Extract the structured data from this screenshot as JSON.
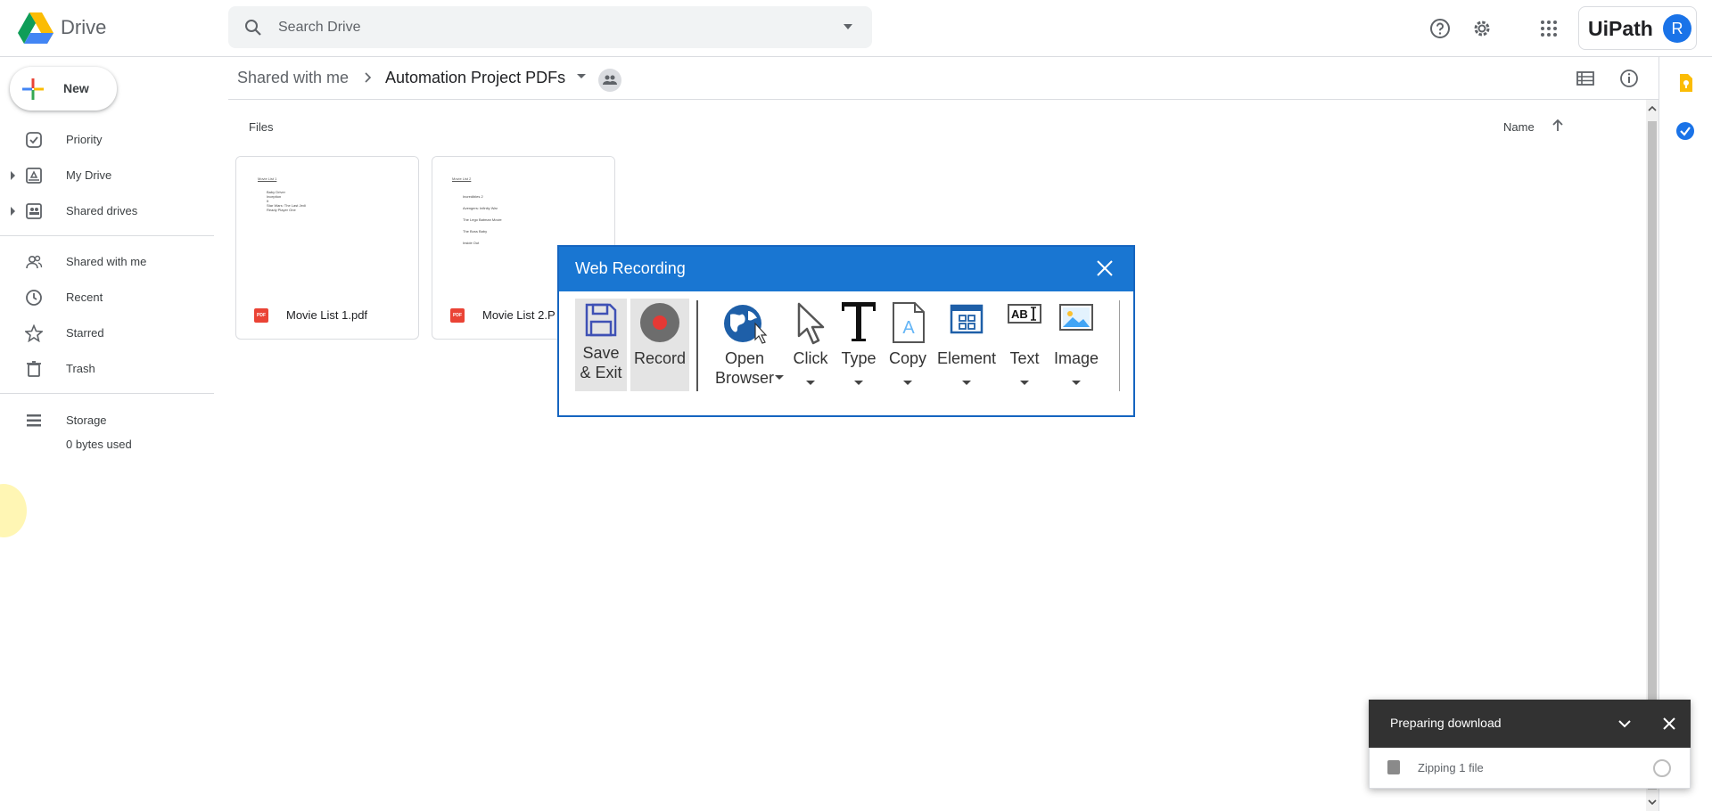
{
  "app": {
    "name": "Drive"
  },
  "search": {
    "placeholder": "Search Drive"
  },
  "header": {
    "account_brand": "UiPath",
    "avatar_initial": "R"
  },
  "sidebar": {
    "new_label": "New",
    "items": [
      {
        "label": "Priority",
        "icon": "priority-icon"
      },
      {
        "label": "My Drive",
        "icon": "my-drive-icon"
      },
      {
        "label": "Shared drives",
        "icon": "shared-drives-icon"
      },
      {
        "label": "Shared with me",
        "icon": "shared-with-me-icon"
      },
      {
        "label": "Recent",
        "icon": "clock-icon"
      },
      {
        "label": "Starred",
        "icon": "star-icon"
      },
      {
        "label": "Trash",
        "icon": "trash-icon"
      },
      {
        "label": "Storage",
        "icon": "storage-icon"
      }
    ],
    "storage_used": "0 bytes used"
  },
  "breadcrumb": {
    "parent": "Shared with me",
    "current": "Automation Project PDFs"
  },
  "files": {
    "section_label": "Files",
    "sort_label": "Name",
    "items": [
      {
        "name": "Movie List 1.pdf",
        "type_badge": "PDF",
        "thumb_title": "Movie List 1",
        "thumb_lines": [
          "Baby Driver",
          "Inception",
          "It",
          "Star Wars: The Last Jedi",
          "Ready Player One"
        ]
      },
      {
        "name": "Movie List 2.P",
        "type_badge": "PDF",
        "thumb_title": "Movie List 2",
        "thumb_lines": [
          "Incredibles 2",
          "Avengers: Infinity War",
          "The Lego Batman Movie",
          "The Boss Baby",
          "Inside Out"
        ]
      }
    ]
  },
  "recorder": {
    "title": "Web Recording",
    "tools": [
      {
        "label": "Save & Exit",
        "icon": "save-icon"
      },
      {
        "label": "Record",
        "icon": "record-icon"
      },
      {
        "label": "Open Browser",
        "icon": "globe-icon"
      },
      {
        "label": "Click",
        "icon": "cursor-icon"
      },
      {
        "label": "Type",
        "icon": "type-icon"
      },
      {
        "label": "Copy",
        "icon": "copy-icon"
      },
      {
        "label": "Element",
        "icon": "element-icon"
      },
      {
        "label": "Text",
        "icon": "text-icon"
      },
      {
        "label": "Image",
        "icon": "image-icon"
      }
    ]
  },
  "download": {
    "title": "Preparing download",
    "status": "Zipping 1 file"
  },
  "colors": {
    "recorder_accent": "#1976d2",
    "record_red": "#e53935",
    "drive_blue": "#1a73e8",
    "toast_bg": "#323232"
  }
}
